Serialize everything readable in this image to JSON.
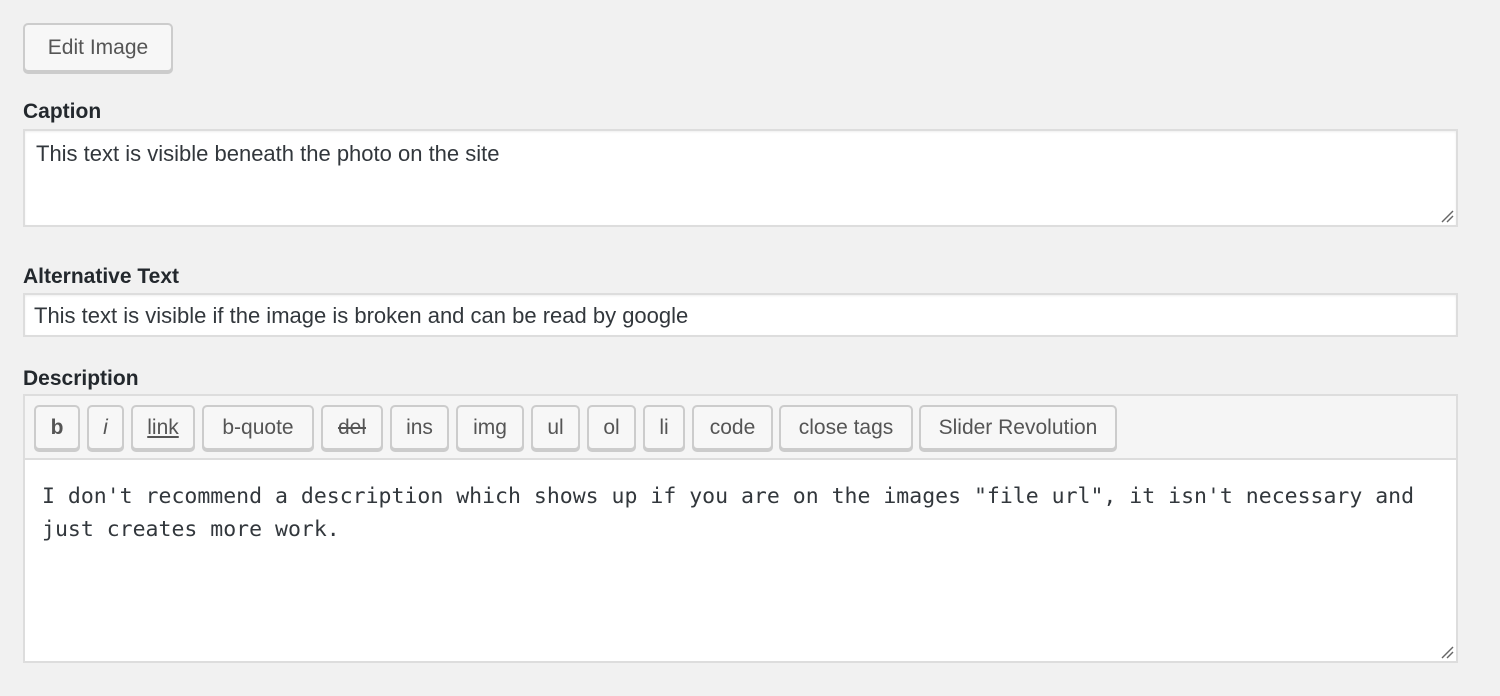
{
  "edit_image_button": {
    "label": "Edit Image"
  },
  "caption": {
    "label": "Caption",
    "value": "This text is visible beneath the photo on the site"
  },
  "alt_text": {
    "label": "Alternative Text",
    "value": "This text is visible if the image is broken and can be read by google"
  },
  "description": {
    "label": "Description",
    "toolbar": [
      {
        "label": "b",
        "name": "bold"
      },
      {
        "label": "i",
        "name": "italic"
      },
      {
        "label": "link",
        "name": "link"
      },
      {
        "label": "b-quote",
        "name": "blockquote"
      },
      {
        "label": "del",
        "name": "del"
      },
      {
        "label": "ins",
        "name": "ins"
      },
      {
        "label": "img",
        "name": "img"
      },
      {
        "label": "ul",
        "name": "ul"
      },
      {
        "label": "ol",
        "name": "ol"
      },
      {
        "label": "li",
        "name": "li"
      },
      {
        "label": "code",
        "name": "code"
      },
      {
        "label": "close tags",
        "name": "close-tags"
      },
      {
        "label": "Slider Revolution",
        "name": "slider-revolution"
      }
    ],
    "value": "I don't recommend a description which shows up if you are on the images \"file url\", it isn't necessary and just creates more work."
  },
  "icons": {
    "resize_grip": "resize-grip-icon"
  }
}
